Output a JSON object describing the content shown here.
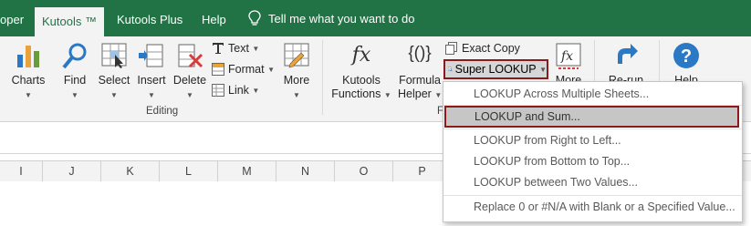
{
  "tabs": [
    {
      "label": "oper",
      "active": false
    },
    {
      "label": "Kutools ™",
      "active": true
    },
    {
      "label": "Kutools Plus",
      "active": false
    },
    {
      "label": "Help",
      "active": false
    }
  ],
  "tell_me": "Tell me what you want to do",
  "ribbon": {
    "charts": "Charts",
    "find": "Find",
    "select": "Select",
    "insert": "Insert",
    "delete": "Delete",
    "text": "Text",
    "format": "Format",
    "link": "Link",
    "more": "More",
    "editing_group": "Editing",
    "kutools_functions_1": "Kutools",
    "kutools_functions_2": "Functions",
    "formula_helper_1": "Formula",
    "formula_helper_2": "Helper",
    "exact_copy": "Exact Copy",
    "super_lookup": "Super LOOKUP",
    "more2": "More",
    "rerun": "Re-run",
    "help": "Help",
    "fx_glyph": "fx",
    "braces_glyph": "{()}",
    "group_f_partial": "F"
  },
  "columns": [
    "I",
    "J",
    "K",
    "L",
    "M",
    "N",
    "O",
    "P"
  ],
  "menu": {
    "items": [
      "LOOKUP Across Multiple Sheets...",
      "LOOKUP and Sum...",
      "LOOKUP from Right to Left...",
      "LOOKUP from Bottom to Top...",
      "LOOKUP between Two Values...",
      "Replace 0 or #N/A with Blank or a Specified Value..."
    ]
  },
  "colors": {
    "brand_green": "#217346",
    "ribbon_bg": "#f3f3f3",
    "highlight_border": "#8b1a1a",
    "icon_blue": "#2b78c5"
  }
}
